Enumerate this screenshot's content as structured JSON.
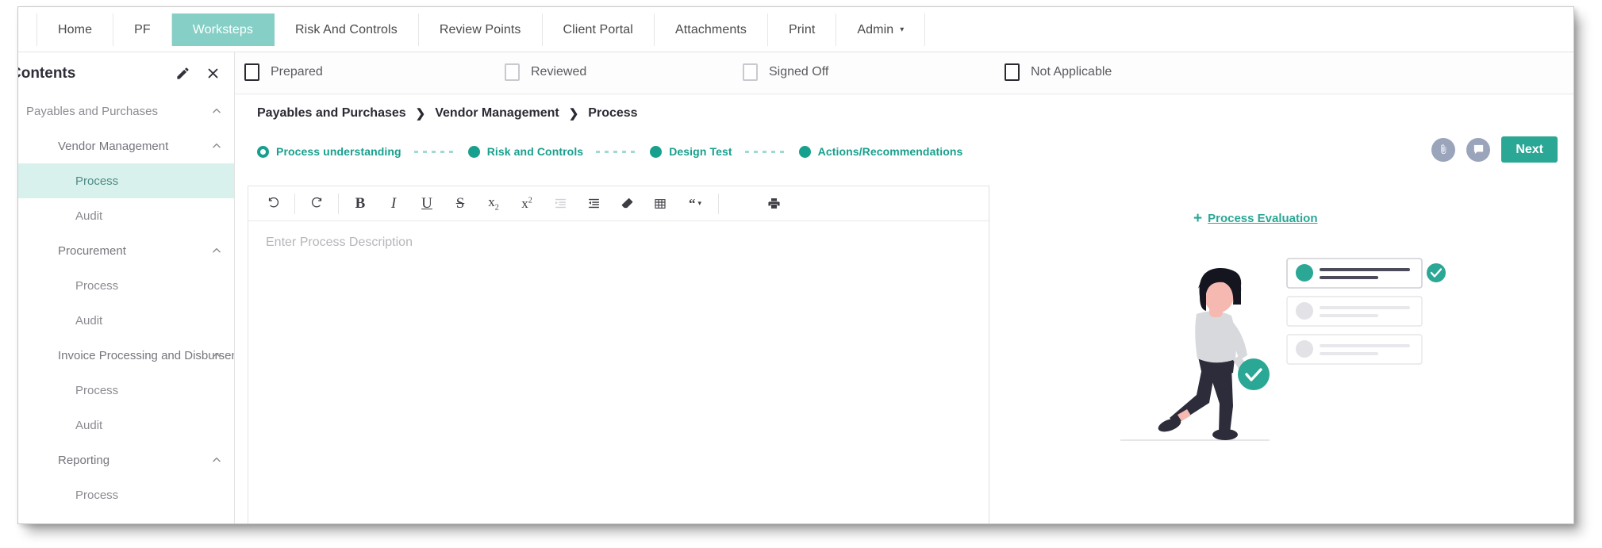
{
  "tabs": [
    {
      "label": "Home",
      "active": false,
      "caret": false
    },
    {
      "label": "PF",
      "active": false,
      "caret": false
    },
    {
      "label": "Worksteps",
      "active": true,
      "caret": false
    },
    {
      "label": "Risk And Controls",
      "active": false,
      "caret": false
    },
    {
      "label": "Review Points",
      "active": false,
      "caret": false
    },
    {
      "label": "Client Portal",
      "active": false,
      "caret": false
    },
    {
      "label": "Attachments",
      "active": false,
      "caret": false
    },
    {
      "label": "Print",
      "active": false,
      "caret": false
    },
    {
      "label": "Admin",
      "active": false,
      "caret": true
    }
  ],
  "caret_glyph": "▾",
  "sidebar": {
    "title": "Contents",
    "actions": [
      {
        "name": "edit-icon"
      },
      {
        "name": "close-icon"
      }
    ],
    "tree": [
      {
        "label": "Payables and Purchases",
        "level": 0,
        "chevron": "up",
        "selected": false
      },
      {
        "label": "Vendor Management",
        "level": 1,
        "chevron": "up",
        "selected": false
      },
      {
        "label": "Process",
        "level": 2,
        "chevron": "",
        "selected": true
      },
      {
        "label": "Audit",
        "level": 2,
        "chevron": "",
        "selected": false
      },
      {
        "label": "Procurement",
        "level": 1,
        "chevron": "up",
        "selected": false
      },
      {
        "label": "Process",
        "level": 2,
        "chevron": "",
        "selected": false
      },
      {
        "label": "Audit",
        "level": 2,
        "chevron": "",
        "selected": false
      },
      {
        "label": "Invoice Processing and Disbursement",
        "level": 1,
        "chevron": "up",
        "selected": false
      },
      {
        "label": "Process",
        "level": 2,
        "chevron": "",
        "selected": false
      },
      {
        "label": "Audit",
        "level": 2,
        "chevron": "",
        "selected": false
      },
      {
        "label": "Reporting",
        "level": 1,
        "chevron": "up",
        "selected": false
      },
      {
        "label": "Process",
        "level": 2,
        "chevron": "",
        "selected": false
      }
    ]
  },
  "status_row": [
    {
      "label": "Prepared",
      "checked": false,
      "emphasis": true
    },
    {
      "label": "Reviewed",
      "checked": false,
      "emphasis": false
    },
    {
      "label": "Signed Off",
      "checked": false,
      "emphasis": false
    },
    {
      "label": "Not Applicable",
      "checked": false,
      "emphasis": true
    }
  ],
  "breadcrumb": {
    "separator": "❯",
    "items": [
      "Payables and Purchases",
      "Vendor Management",
      "Process"
    ]
  },
  "stepper": {
    "steps": [
      {
        "label": "Process understanding",
        "state": "current"
      },
      {
        "label": "Risk and Controls",
        "state": "completed"
      },
      {
        "label": "Design Test",
        "state": "completed"
      },
      {
        "label": "Actions/Recommendations",
        "state": "completed"
      }
    ]
  },
  "header_actions": {
    "attachment_icon": "paperclip-icon",
    "comment_icon": "comment-icon",
    "next_label": "Next"
  },
  "editor": {
    "placeholder": "Enter Process Description",
    "toolbar": [
      {
        "name": "undo-icon",
        "glyph": "↺",
        "dim": false,
        "sep_after": true
      },
      {
        "name": "redo-icon",
        "glyph": "↻",
        "dim": false,
        "sep_after": true
      },
      {
        "name": "bold-icon",
        "glyph": "B",
        "dim": false,
        "sep_after": false
      },
      {
        "name": "italic-icon",
        "glyph": "I",
        "dim": false,
        "sep_after": false
      },
      {
        "name": "underline-icon",
        "glyph": "U",
        "dim": false,
        "sep_after": false
      },
      {
        "name": "strikethrough-icon",
        "glyph": "S",
        "dim": false,
        "sep_after": false
      },
      {
        "name": "subscript-icon",
        "glyph": "x",
        "dim": false,
        "sep_after": false
      },
      {
        "name": "superscript-icon",
        "glyph": "x",
        "dim": false,
        "sep_after": false
      },
      {
        "name": "outdent-icon",
        "glyph": "",
        "dim": true,
        "sep_after": false
      },
      {
        "name": "indent-icon",
        "glyph": "",
        "dim": false,
        "sep_after": false
      },
      {
        "name": "eraser-icon",
        "glyph": "",
        "dim": false,
        "sep_after": false
      },
      {
        "name": "table-icon",
        "glyph": "",
        "dim": false,
        "sep_after": false
      },
      {
        "name": "blockquote-icon",
        "glyph": "“",
        "dim": false,
        "sep_after": true
      },
      {
        "name": "source-code-icon",
        "glyph": "</>",
        "dim": false,
        "sep_after": false
      },
      {
        "name": "print-icon",
        "glyph": "",
        "dim": false,
        "sep_after": false
      }
    ]
  },
  "right_panel": {
    "process_evaluation_label": "Process Evaluation",
    "plus_glyph": "+",
    "illustration_name": "person-checklist-illustration",
    "checklist_cards": [
      {
        "state": "done",
        "lines": 2,
        "badge": true
      },
      {
        "state": "pending",
        "lines": 2,
        "badge": false
      },
      {
        "state": "pending",
        "lines": 2,
        "badge": false
      }
    ]
  },
  "colors": {
    "teal": "#2aa795",
    "teal_step": "#17a08d",
    "active_tab": "#86cfc6",
    "selected_row": "#d8f1ed",
    "muted_text": "#8b8b92",
    "round_btn": "#9aa4bb"
  }
}
